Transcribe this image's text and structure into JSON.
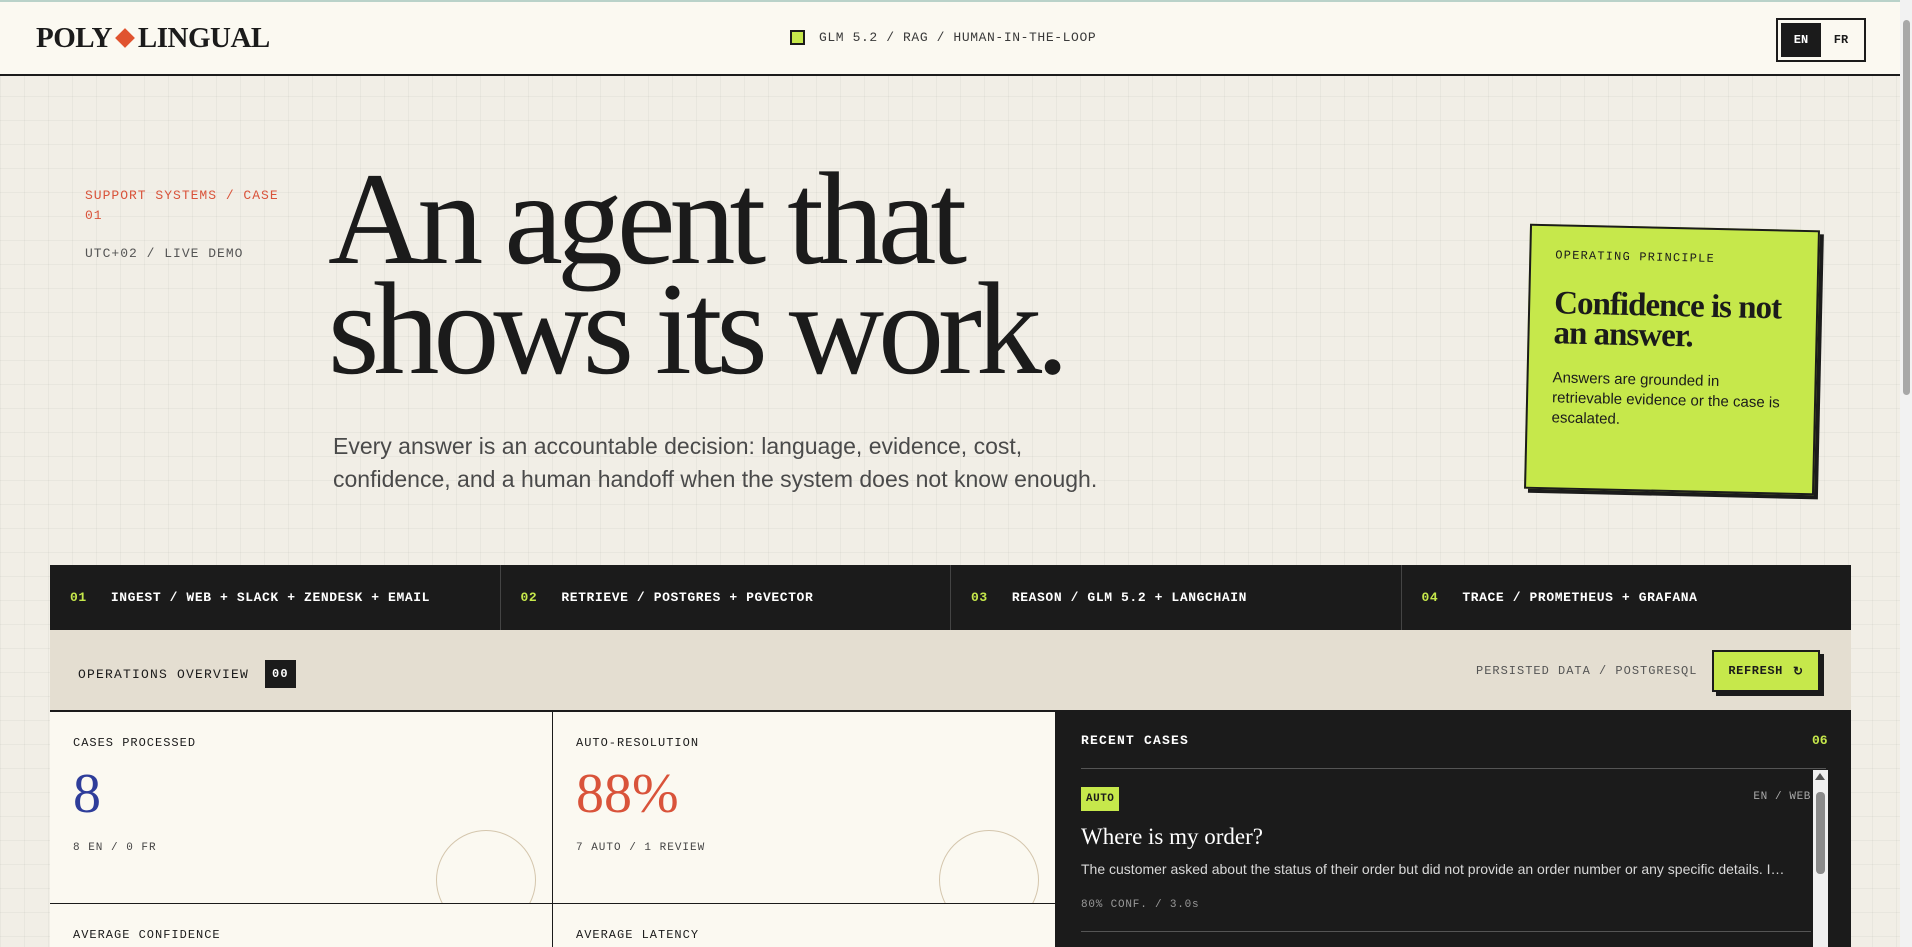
{
  "header": {
    "logo_left": "POLY",
    "logo_right": "LINGUAL",
    "stack": "GLM 5.2 / RAG / HUMAN-IN-THE-LOOP",
    "lang": {
      "en": "EN",
      "fr": "FR",
      "active": "EN"
    }
  },
  "hero": {
    "kicker": "SUPPORT SYSTEMS / CASE 01",
    "timezone": "UTC+02 / LIVE DEMO",
    "headline_line1": "An agent that",
    "headline_line2": "shows its work.",
    "lede": "Every answer is an accountable decision: language, evidence, cost, confidence, and a human handoff when the system does not know enough."
  },
  "principle": {
    "label": "OPERATING PRINCIPLE",
    "title": "Confidence is not an answer.",
    "body": "Answers are grounded in retrievable evidence or the case is escalated."
  },
  "pipeline": [
    {
      "num": "01",
      "label": "INGEST / WEB + SLACK + ZENDESK + EMAIL"
    },
    {
      "num": "02",
      "label": "RETRIEVE / POSTGRES + PGVECTOR"
    },
    {
      "num": "03",
      "label": "REASON / GLM 5.2 + LANGCHAIN"
    },
    {
      "num": "04",
      "label": "TRACE / PROMETHEUS + GRAFANA"
    }
  ],
  "operations": {
    "title": "OPERATIONS OVERVIEW",
    "count": "00",
    "persisted": "PERSISTED DATA / POSTGRESQL",
    "refresh_label": "REFRESH",
    "refresh_icon": "↻"
  },
  "metrics": {
    "cases": {
      "label": "CASES PROCESSED",
      "value": "8",
      "sub": "8 EN / 0 FR",
      "color": "#2e3d9a"
    },
    "auto": {
      "label": "AUTO-RESOLUTION",
      "value": "88%",
      "sub": "7 AUTO / 1 REVIEW",
      "color": "#d9533a"
    },
    "confidence": {
      "label": "AVERAGE CONFIDENCE"
    },
    "latency": {
      "label": "AVERAGE LATENCY"
    }
  },
  "recent": {
    "title": "RECENT CASES",
    "count": "06",
    "cases": [
      {
        "badge": "AUTO",
        "channel": "EN / WEB",
        "title": "Where is my order?",
        "desc": "The customer asked about the status of their order but did not provide an order number or any specific details. I…",
        "meta": "80% CONF. / 3.0s"
      }
    ]
  },
  "colors": {
    "accent": "#c6e84b",
    "ink": "#1b1b1b",
    "coral": "#e0532f",
    "paper": "#f1eee6"
  }
}
